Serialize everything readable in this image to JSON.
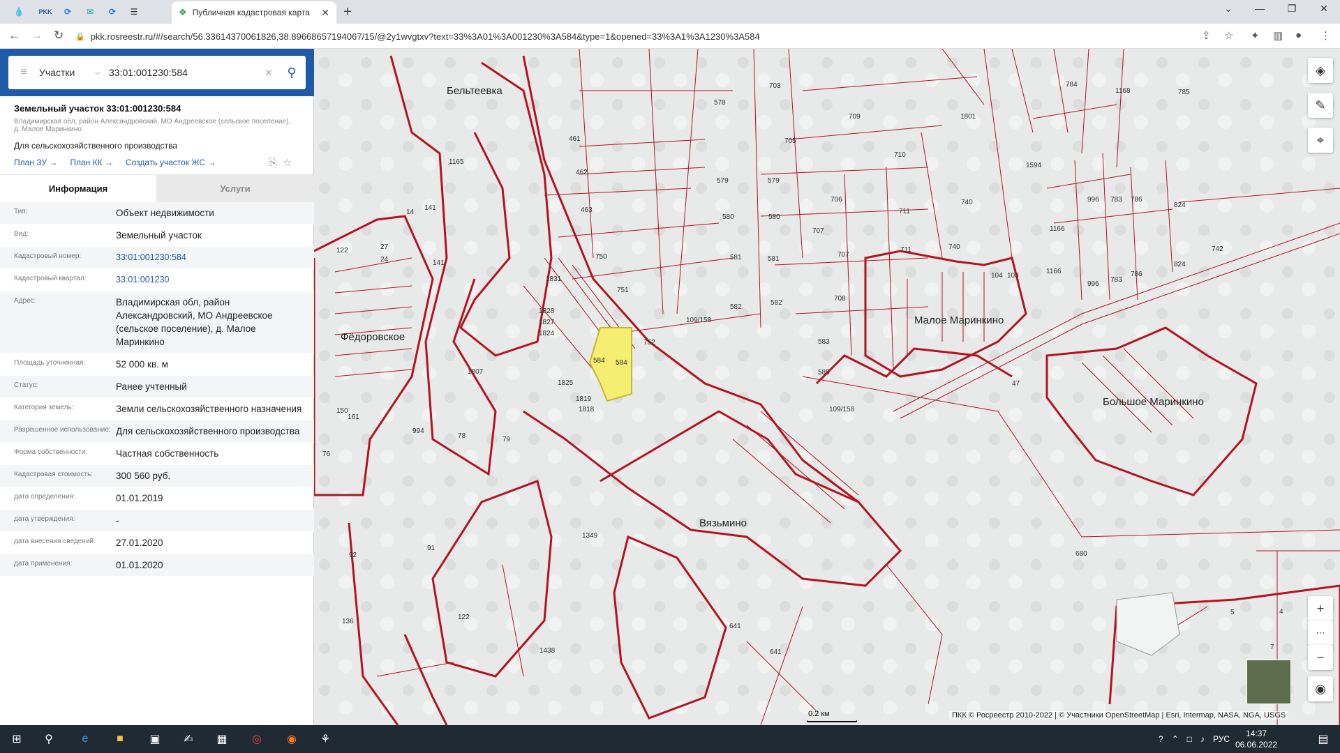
{
  "browser": {
    "tab_title": "Публичная кадастровая карта",
    "url": "pkk.rosreestr.ru/#/search/56.33614370061826,38.89668657194067/15/@2y1wvgtxv?text=33%3A01%3A001230%3A584&type=1&opened=33%3A1%3A1230%3A584",
    "pinned_tabs": [
      "water-icon",
      "rkk-icon",
      "sync-icon",
      "mail-icon",
      "cloud-icon",
      "list-icon"
    ]
  },
  "search": {
    "mode": "Участки",
    "query": "33:01:001230:584"
  },
  "parcel": {
    "title": "Земельный участок 33:01:001230:584",
    "address_short": "Владимирская обл, район Александровский, МО Андреевское (сельское поселение), д. Малое Маринкино",
    "purpose": "Для сельскохозяйственного производства",
    "links": [
      "План ЗУ →",
      "План КК →",
      "Создать участок ЖС →"
    ]
  },
  "tabs": {
    "info": "Информация",
    "services": "Услуги"
  },
  "rows": [
    {
      "label": "Тип:",
      "value": "Объект недвижимости"
    },
    {
      "label": "Вид:",
      "value": "Земельный участок"
    },
    {
      "label": "Кадастровый номер:",
      "value": "33:01:001230:584",
      "link": true
    },
    {
      "label": "Кадастровый квартал:",
      "value": "33:01:001230",
      "link": true
    },
    {
      "label": "Адрес:",
      "value": "Владимирская обл, район Александровский, МО Андреевское (сельское поселение), д. Малое Маринкино"
    },
    {
      "label": "Площадь уточненная:",
      "value": "52 000 кв. м"
    },
    {
      "label": "Статус:",
      "value": "Ранее учтенный"
    },
    {
      "label": "Категория земель:",
      "value": "Земли сельскохозяйственного назначения"
    },
    {
      "label": "Разрешенное использование:",
      "value": "Для сельскохозяйственного производства"
    },
    {
      "label": "Форма собственности:",
      "value": "Частная собственность"
    },
    {
      "label": "Кадастровая стоимость:",
      "value": "300 560 руб."
    },
    {
      "label": "дата определения:",
      "value": "01.01.2019"
    },
    {
      "label": "дата утверждения:",
      "value": "-"
    },
    {
      "label": "дата внесения сведений:",
      "value": "27.01.2020"
    },
    {
      "label": "дата применения:",
      "value": "01.01.2020"
    }
  ],
  "map": {
    "places": [
      "Бельтеевка",
      "Фёдоровское",
      "Малое Маринкино",
      "Большое Маринкино",
      "Вязьмино"
    ],
    "parcel_labels": [
      "703",
      "578",
      "709",
      "1801",
      "784",
      "1168",
      "785",
      "705",
      "710",
      "1594",
      "461",
      "462",
      "1165",
      "579",
      "579",
      "706",
      "740",
      "996",
      "783",
      "786",
      "824",
      "463",
      "580",
      "580",
      "711",
      "1166",
      "707",
      "742",
      "750",
      "707",
      "581",
      "711",
      "740",
      "104",
      "103",
      "581",
      "1166",
      "996",
      "783",
      "786",
      "824",
      "751",
      "582",
      "582",
      "708",
      "109/158",
      "752",
      "583",
      "47",
      "585",
      "1807",
      "109/158",
      "994",
      "78",
      "79",
      "76",
      "1349",
      "92",
      "91",
      "122",
      "136",
      "1438",
      "641",
      "641",
      "680",
      "5",
      "4",
      "7",
      "584",
      "584",
      "14",
      "141",
      "27",
      "24",
      "122",
      "141",
      "1831",
      "1828",
      "1827",
      "1824",
      "1825",
      "1819",
      "1818",
      "150",
      "161"
    ],
    "scale": "0.2 км",
    "attribution": "ПКК © Росреестр 2010-2022 | © Участники OpenStreetMap | Esri, Intermap, NASA, NGA, USGS"
  },
  "taskbar": {
    "lang": "РУС",
    "time": "14:37",
    "date": "06.06.2022"
  }
}
